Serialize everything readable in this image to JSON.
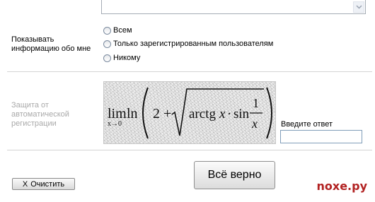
{
  "form": {
    "visibility": {
      "label": [
        "Показывать",
        "информацию обо мне"
      ],
      "options": [
        "Всем",
        "Только зарегистрированным пользователям",
        "Никому"
      ],
      "selected": null
    },
    "captcha": {
      "label": [
        "Защита от",
        "автоматической",
        "регистрации"
      ],
      "formula": {
        "lim": "lim",
        "sub": "x→0",
        "ln": "ln",
        "two_plus": "2 +",
        "arctg": "arctg",
        "x1": "x",
        "dot": "·",
        "sin": "sin",
        "num": "1",
        "den": "x"
      },
      "answer_label": "Введите ответ",
      "answer_value": ""
    },
    "submit_label": "Всё верно",
    "clear_label": "Очистить",
    "clear_icon": "X"
  },
  "watermark": "noxe.ру"
}
